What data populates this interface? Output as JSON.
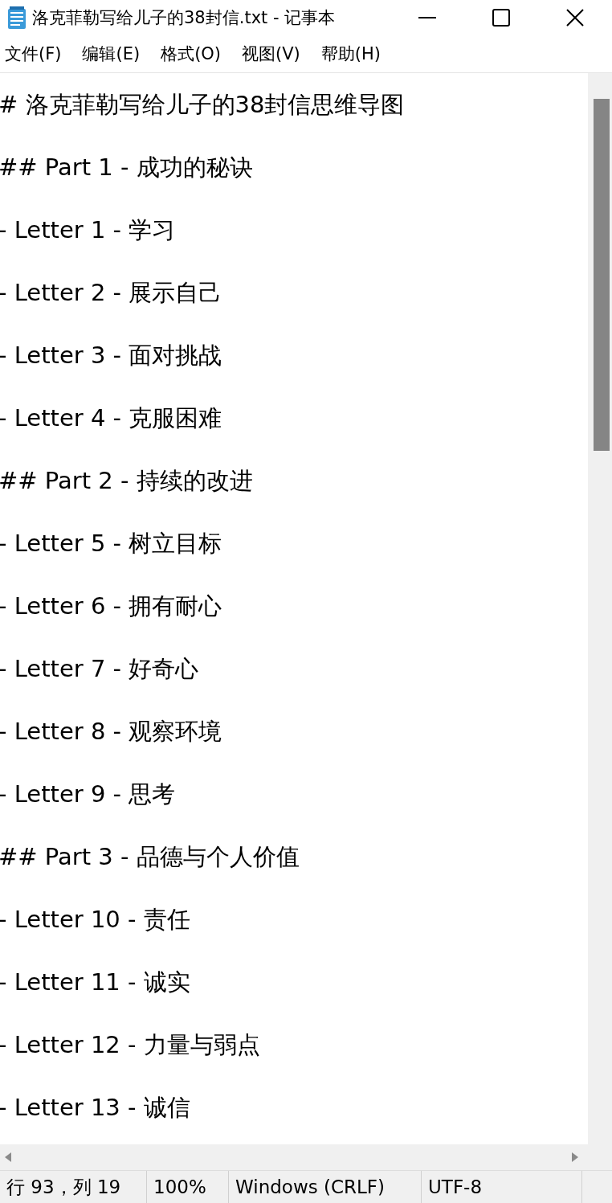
{
  "window": {
    "title": "洛克菲勒写给儿子的38封信.txt - 记事本"
  },
  "menu": [
    "文件(F)",
    "编辑(E)",
    "格式(O)",
    "视图(V)",
    "帮助(H)"
  ],
  "lines": [
    "# 洛克菲勒写给儿子的38封信思维导图",
    "## Part 1 - 成功的秘诀",
    "- Letter 1 - 学习",
    "- Letter 2 - 展示自己",
    "- Letter 3 - 面对挑战",
    "- Letter 4 - 克服困难",
    "## Part 2 - 持续的改进",
    "- Letter 5 - 树立目标",
    "- Letter 6 - 拥有耐心",
    "- Letter 7 - 好奇心",
    "- Letter 8 - 观察环境",
    "- Letter 9 - 思考",
    "## Part 3 - 品德与个人价值",
    "- Letter 10 - 责任",
    "- Letter 11 - 诚实",
    "- Letter 12 - 力量与弱点",
    "- Letter 13 - 诚信"
  ],
  "status_bar": [
    "行 93，列 19",
    "100%",
    "Windows (CRLF)",
    "UTF-8"
  ]
}
